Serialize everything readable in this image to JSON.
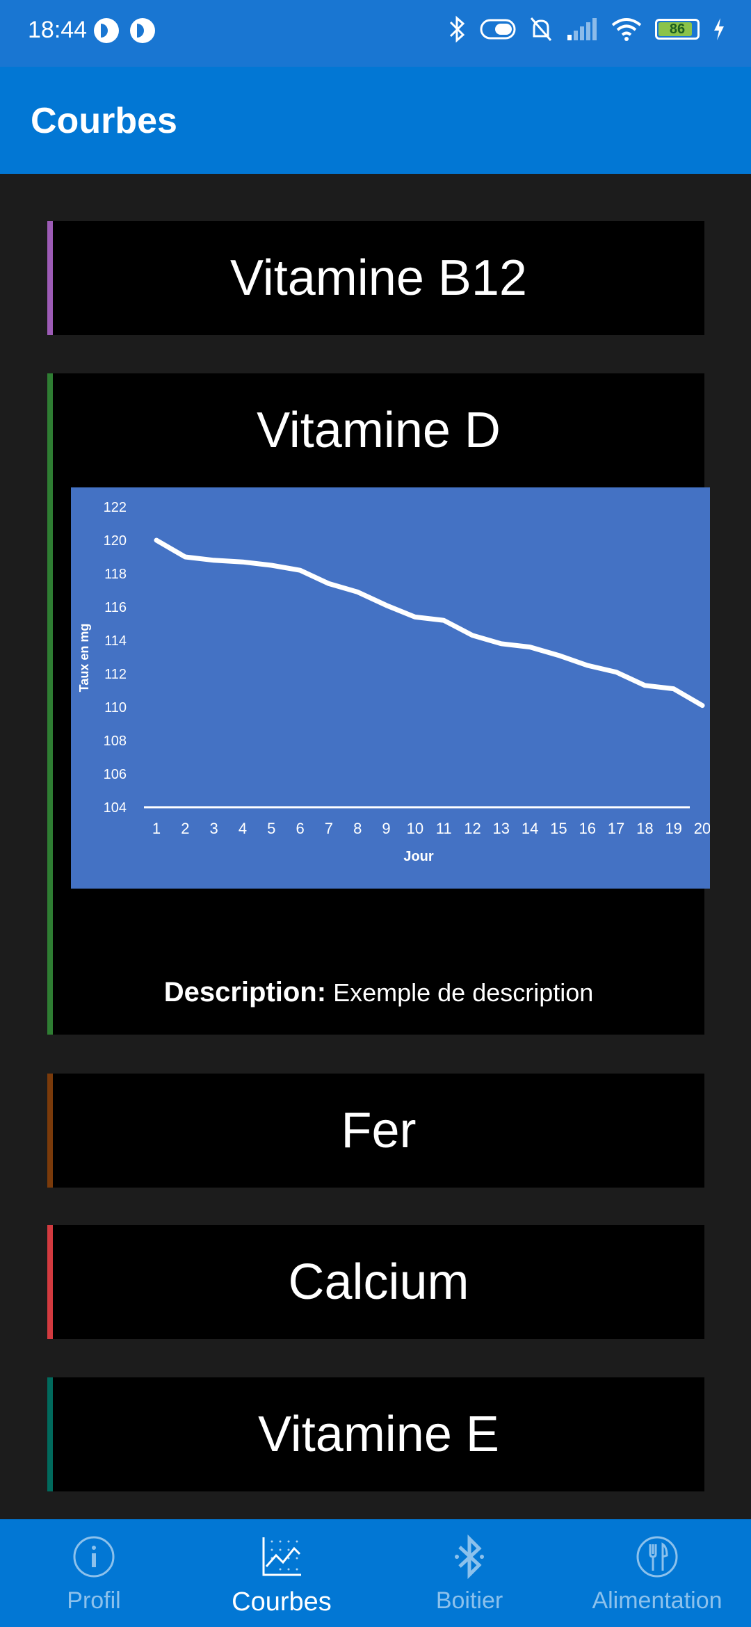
{
  "status": {
    "time": "18:44",
    "battery": "86"
  },
  "appbar": {
    "title": "Courbes"
  },
  "cards": [
    {
      "title": "Vitamine B12",
      "color": "#9c5bb5"
    },
    {
      "title": "Vitamine D",
      "color": "#2e7d32",
      "description_label": "Description:",
      "description_text": "Exemple de description"
    },
    {
      "title": "Fer",
      "color": "#7a3a0a"
    },
    {
      "title": "Calcium",
      "color": "#d23a3f"
    },
    {
      "title": "Vitamine E",
      "color": "#00695c"
    }
  ],
  "chart_data": {
    "type": "line",
    "x": [
      1,
      2,
      3,
      4,
      5,
      6,
      7,
      8,
      9,
      10,
      11,
      12,
      13,
      14,
      15,
      16,
      17,
      18,
      19,
      20
    ],
    "series": [
      {
        "values": [
          120,
          119,
          118.8,
          118.7,
          118.5,
          118.2,
          117.4,
          116.9,
          116.1,
          115.4,
          115.2,
          114.3,
          113.8,
          113.6,
          113.1,
          112.5,
          112.1,
          111.3,
          111.1,
          110.1
        ]
      }
    ],
    "xlabel": "Jour",
    "ylabel": "Taux en mg",
    "ylim": [
      104,
      122
    ],
    "yticks": [
      104,
      106,
      108,
      110,
      112,
      114,
      116,
      118,
      120,
      122
    ],
    "background": "#4472c4"
  },
  "nav": [
    {
      "label": "Profil",
      "icon": "info-icon",
      "active": false
    },
    {
      "label": "Courbes",
      "icon": "chart-icon",
      "active": true
    },
    {
      "label": "Boitier",
      "icon": "bluetooth-icon",
      "active": false
    },
    {
      "label": "Alimentation",
      "icon": "utensils-icon",
      "active": false
    }
  ]
}
